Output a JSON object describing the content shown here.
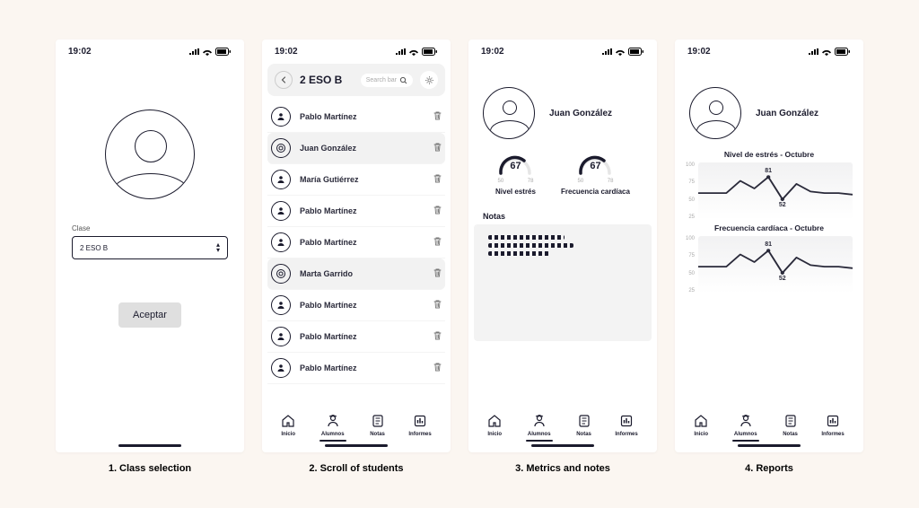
{
  "status": {
    "time": "19:02"
  },
  "captions": [
    "1.  Class selection",
    "2.  Scroll of students",
    "3.  Metrics and notes",
    "4.  Reports"
  ],
  "frame1": {
    "field_label": "Clase",
    "select_value": "2 ESO B",
    "accept": "Aceptar"
  },
  "frame2": {
    "title": "2 ESO B",
    "search_placeholder": "Search bar",
    "students": [
      {
        "name": "Pablo Martínez",
        "selected": false,
        "icon": "user"
      },
      {
        "name": "Juan González",
        "selected": true,
        "icon": "target"
      },
      {
        "name": "María Gutiérrez",
        "selected": false,
        "icon": "user"
      },
      {
        "name": "Pablo Martínez",
        "selected": false,
        "icon": "user"
      },
      {
        "name": "Pablo Martínez",
        "selected": false,
        "icon": "user"
      },
      {
        "name": "Marta Garrido",
        "selected": true,
        "icon": "target"
      },
      {
        "name": "Pablo Martínez",
        "selected": false,
        "icon": "user"
      },
      {
        "name": "Pablo Martínez",
        "selected": false,
        "icon": "user"
      },
      {
        "name": "Pablo Martínez",
        "selected": false,
        "icon": "user"
      }
    ]
  },
  "nav": {
    "items": [
      {
        "label": "Inicio"
      },
      {
        "label": "Alumnos"
      },
      {
        "label": "Notas"
      },
      {
        "label": "Informes"
      }
    ],
    "active_index": 1
  },
  "frame3": {
    "student": "Juan González",
    "gauges": [
      {
        "value": "67",
        "min": "50",
        "max": "78",
        "label": "Nivel estrés"
      },
      {
        "value": "67",
        "min": "50",
        "max": "78",
        "label": "Frecuencia cardíaca"
      }
    ],
    "notes_heading": "Notas"
  },
  "frame4": {
    "student": "Juan González",
    "charts": [
      {
        "title": "Nivel de estrés - Octubre",
        "y": [
          "100",
          "75",
          "50",
          "25"
        ],
        "high": "81",
        "low": "52"
      },
      {
        "title": "Frecuencia cardíaca - Octubre",
        "y": [
          "100",
          "75",
          "50",
          "25"
        ],
        "high": "81",
        "low": "52"
      }
    ]
  },
  "chart_data": [
    {
      "type": "line",
      "title": "Nivel de estrés - Octubre",
      "ylim": [
        25,
        100
      ],
      "annotations": {
        "high": 81,
        "low": 52
      },
      "x": [
        0,
        1,
        2,
        3,
        4,
        5,
        6,
        7,
        8,
        9,
        10,
        11
      ],
      "values": [
        60,
        60,
        60,
        76,
        66,
        81,
        52,
        72,
        62,
        60,
        60,
        58
      ]
    },
    {
      "type": "line",
      "title": "Frecuencia cardíaca - Octubre",
      "ylim": [
        25,
        100
      ],
      "annotations": {
        "high": 81,
        "low": 52
      },
      "x": [
        0,
        1,
        2,
        3,
        4,
        5,
        6,
        7,
        8,
        9,
        10,
        11
      ],
      "values": [
        60,
        60,
        60,
        76,
        66,
        81,
        52,
        72,
        62,
        60,
        60,
        58
      ]
    }
  ]
}
